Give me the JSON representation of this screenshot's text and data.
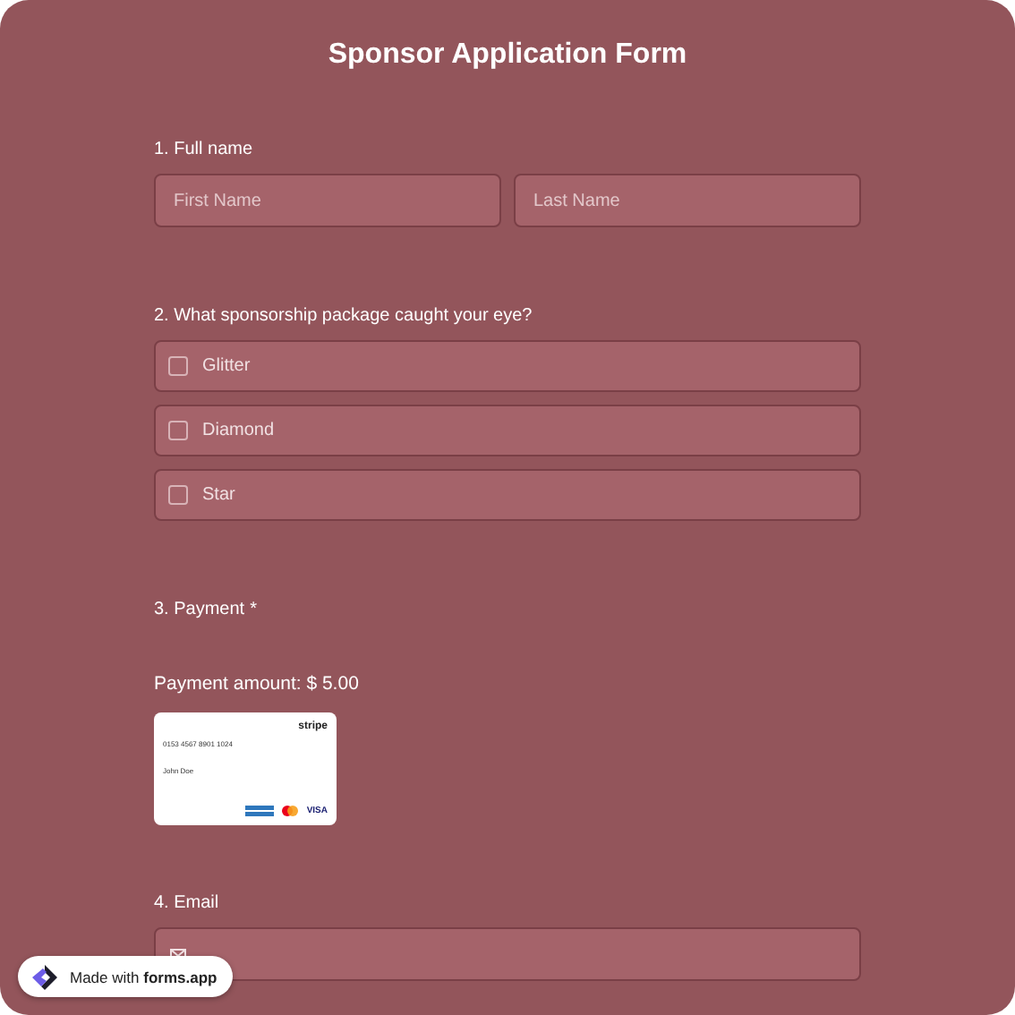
{
  "title": "Sponsor Application Form",
  "full_name": {
    "label": "1.  Full name",
    "fields": [
      {
        "placeholder": "First Name"
      },
      {
        "placeholder": "Last Name"
      }
    ]
  },
  "package": {
    "label": "2. What sponsorship package caught your eye?",
    "options": [
      {
        "label": "Glitter",
        "checked": false
      },
      {
        "label": "Diamond",
        "checked": false
      },
      {
        "label": "Star",
        "checked": false
      }
    ]
  },
  "payment": {
    "label": "3. Payment",
    "required_mark": "*",
    "amount": "Payment amount: $ 5.00",
    "card": {
      "brand": "stripe",
      "number": "0153 4567 8901 1024",
      "holder": "John Doe",
      "network": "VISA"
    }
  },
  "email": {
    "label": "4. Email"
  },
  "badge": {
    "prefix": "Made with ",
    "brand": "forms.app"
  }
}
